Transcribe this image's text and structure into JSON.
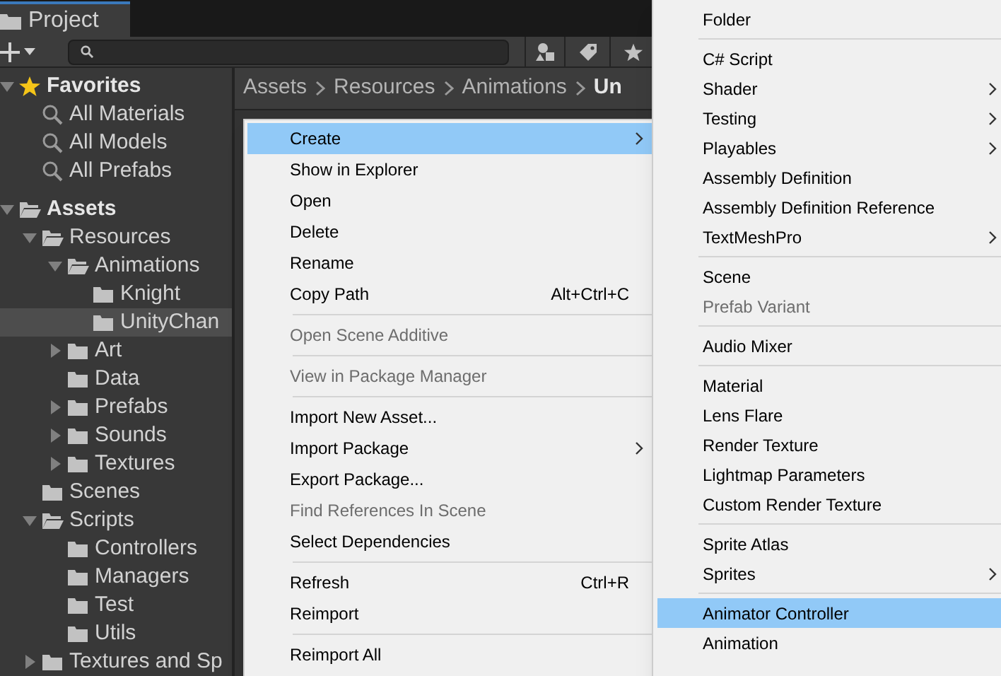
{
  "tab": {
    "label": "Project",
    "selected": true
  },
  "tree": [
    {
      "label": "Favorites",
      "kind": "favorites",
      "expanded": true,
      "children": [
        {
          "label": "All Materials",
          "kind": "search"
        },
        {
          "label": "All Models",
          "kind": "search"
        },
        {
          "label": "All Prefabs",
          "kind": "search"
        }
      ]
    },
    {
      "kind": "spacer"
    },
    {
      "label": "Assets",
      "kind": "root",
      "expanded": true,
      "children": [
        {
          "label": "Resources",
          "kind": "folder",
          "expanded": true,
          "children": [
            {
              "label": "Animations",
              "kind": "folder",
              "expanded": true,
              "children": [
                {
                  "label": "Knight",
                  "kind": "folder",
                  "selected": false
                },
                {
                  "label": "UnityChan",
                  "kind": "folder",
                  "selected": true
                }
              ]
            },
            {
              "label": "Art",
              "kind": "folder",
              "expanded": false
            },
            {
              "label": "Data",
              "kind": "folder"
            },
            {
              "label": "Prefabs",
              "kind": "folder",
              "expanded": false
            },
            {
              "label": "Sounds",
              "kind": "folder",
              "expanded": false
            },
            {
              "label": "Textures",
              "kind": "folder",
              "expanded": false
            }
          ]
        },
        {
          "label": "Scenes",
          "kind": "folder"
        },
        {
          "label": "Scripts",
          "kind": "folder",
          "expanded": true,
          "children": [
            {
              "label": "Controllers",
              "kind": "folder"
            },
            {
              "label": "Managers",
              "kind": "folder"
            },
            {
              "label": "Test",
              "kind": "folder"
            },
            {
              "label": "Utils",
              "kind": "folder"
            }
          ]
        },
        {
          "label": "Textures and Sp",
          "kind": "folder",
          "expanded": false
        }
      ]
    }
  ],
  "breadcrumb": [
    {
      "label": "Assets",
      "current": false
    },
    {
      "label": "Resources",
      "current": false
    },
    {
      "label": "Animations",
      "current": false
    },
    {
      "label": "Un",
      "current": true
    }
  ],
  "context_menu": [
    {
      "kind": "item",
      "label": "Create",
      "submenu": true,
      "selected": true,
      "disabled": false
    },
    {
      "kind": "item",
      "label": "Show in Explorer",
      "selected": false,
      "disabled": false
    },
    {
      "kind": "item",
      "label": "Open",
      "selected": false,
      "disabled": false
    },
    {
      "kind": "item",
      "label": "Delete",
      "selected": false,
      "disabled": false
    },
    {
      "kind": "item",
      "label": "Rename",
      "selected": false,
      "disabled": false
    },
    {
      "kind": "item",
      "label": "Copy Path",
      "shortcut": "Alt+Ctrl+C",
      "selected": false,
      "disabled": false
    },
    {
      "kind": "separator"
    },
    {
      "kind": "item",
      "label": "Open Scene Additive",
      "selected": false,
      "disabled": true
    },
    {
      "kind": "separator"
    },
    {
      "kind": "item",
      "label": "View in Package Manager",
      "selected": false,
      "disabled": true
    },
    {
      "kind": "separator"
    },
    {
      "kind": "item",
      "label": "Import New Asset...",
      "selected": false,
      "disabled": false
    },
    {
      "kind": "item",
      "label": "Import Package",
      "submenu": true,
      "selected": false,
      "disabled": false
    },
    {
      "kind": "item",
      "label": "Export Package...",
      "selected": false,
      "disabled": false
    },
    {
      "kind": "item",
      "label": "Find References In Scene",
      "selected": false,
      "disabled": true
    },
    {
      "kind": "item",
      "label": "Select Dependencies",
      "selected": false,
      "disabled": false
    },
    {
      "kind": "separator"
    },
    {
      "kind": "item",
      "label": "Refresh",
      "shortcut": "Ctrl+R",
      "selected": false,
      "disabled": false
    },
    {
      "kind": "item",
      "label": "Reimport",
      "selected": false,
      "disabled": false
    },
    {
      "kind": "separator"
    },
    {
      "kind": "item",
      "label": "Reimport All",
      "selected": false,
      "disabled": false
    }
  ],
  "create_submenu": [
    {
      "kind": "item",
      "label": "Folder",
      "selected": false,
      "disabled": false
    },
    {
      "kind": "separator"
    },
    {
      "kind": "item",
      "label": "C# Script",
      "selected": false,
      "disabled": false
    },
    {
      "kind": "item",
      "label": "Shader",
      "submenu": true,
      "selected": false,
      "disabled": false
    },
    {
      "kind": "item",
      "label": "Testing",
      "submenu": true,
      "selected": false,
      "disabled": false
    },
    {
      "kind": "item",
      "label": "Playables",
      "submenu": true,
      "selected": false,
      "disabled": false
    },
    {
      "kind": "item",
      "label": "Assembly Definition",
      "selected": false,
      "disabled": false
    },
    {
      "kind": "item",
      "label": "Assembly Definition Reference",
      "selected": false,
      "disabled": false
    },
    {
      "kind": "item",
      "label": "TextMeshPro",
      "submenu": true,
      "selected": false,
      "disabled": false
    },
    {
      "kind": "separator"
    },
    {
      "kind": "item",
      "label": "Scene",
      "selected": false,
      "disabled": false
    },
    {
      "kind": "item",
      "label": "Prefab Variant",
      "selected": false,
      "disabled": true
    },
    {
      "kind": "separator"
    },
    {
      "kind": "item",
      "label": "Audio Mixer",
      "selected": false,
      "disabled": false
    },
    {
      "kind": "separator"
    },
    {
      "kind": "item",
      "label": "Material",
      "selected": false,
      "disabled": false
    },
    {
      "kind": "item",
      "label": "Lens Flare",
      "selected": false,
      "disabled": false
    },
    {
      "kind": "item",
      "label": "Render Texture",
      "selected": false,
      "disabled": false
    },
    {
      "kind": "item",
      "label": "Lightmap Parameters",
      "selected": false,
      "disabled": false
    },
    {
      "kind": "item",
      "label": "Custom Render Texture",
      "selected": false,
      "disabled": false
    },
    {
      "kind": "separator"
    },
    {
      "kind": "item",
      "label": "Sprite Atlas",
      "selected": false,
      "disabled": false
    },
    {
      "kind": "item",
      "label": "Sprites",
      "submenu": true,
      "selected": false,
      "disabled": false
    },
    {
      "kind": "separator"
    },
    {
      "kind": "item",
      "label": "Animator Controller",
      "selected": true,
      "disabled": false
    },
    {
      "kind": "item",
      "label": "Animation",
      "selected": false,
      "disabled": false
    }
  ]
}
